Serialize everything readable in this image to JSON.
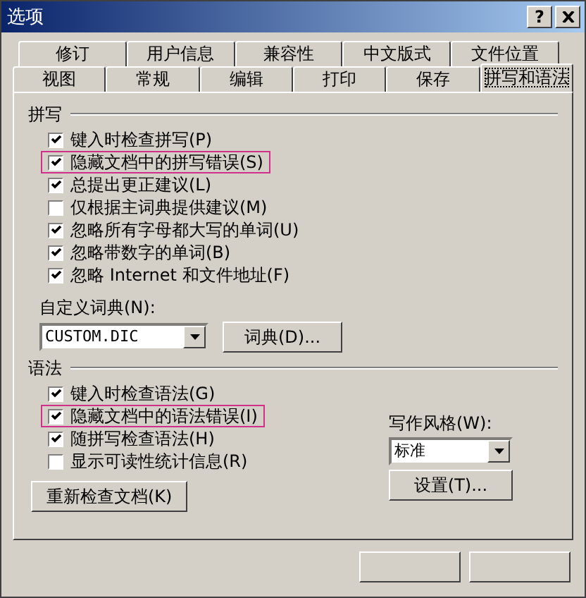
{
  "window": {
    "title": "选项",
    "help_button": "?"
  },
  "tabs": [
    [
      {
        "label": "修订",
        "selected": false
      },
      {
        "label": "用户信息",
        "selected": false
      },
      {
        "label": "兼容性",
        "selected": false
      },
      {
        "label": "中文版式",
        "selected": false
      },
      {
        "label": "文件位置",
        "selected": false
      }
    ],
    [
      {
        "label": "视图",
        "selected": false
      },
      {
        "label": "常规",
        "selected": false
      },
      {
        "label": "编辑",
        "selected": false
      },
      {
        "label": "打印",
        "selected": false
      },
      {
        "label": "保存",
        "selected": false
      },
      {
        "label": "拼写和语法",
        "selected": true
      }
    ]
  ],
  "spelling": {
    "title": "拼写",
    "options": [
      {
        "label": "键入时检查拼写(P)",
        "checked": true,
        "highlighted": false
      },
      {
        "label": "隐藏文档中的拼写错误(S)",
        "checked": true,
        "highlighted": true
      },
      {
        "label": "总提出更正建议(L)",
        "checked": true,
        "highlighted": false
      },
      {
        "label": "仅根据主词典提供建议(M)",
        "checked": false,
        "highlighted": false
      },
      {
        "label": "忽略所有字母都大写的单词(U)",
        "checked": true,
        "highlighted": false
      },
      {
        "label": "忽略带数字的单词(B)",
        "checked": true,
        "highlighted": false
      },
      {
        "label": "忽略 Internet 和文件地址(F)",
        "checked": true,
        "highlighted": false
      }
    ],
    "dictionary_label": "自定义词典(N):",
    "dictionary_value": "CUSTOM.DIC",
    "dictionary_button": "词典(D)..."
  },
  "grammar": {
    "title": "语法",
    "options": [
      {
        "label": "键入时检查语法(G)",
        "checked": true,
        "highlighted": false
      },
      {
        "label": "隐藏文档中的语法错误(I)",
        "checked": true,
        "highlighted": true
      },
      {
        "label": "随拼写检查语法(H)",
        "checked": true,
        "highlighted": false
      },
      {
        "label": "显示可读性统计信息(R)",
        "checked": false,
        "highlighted": false
      }
    ],
    "style_label": "写作风格(W):",
    "style_value": "标准",
    "settings_button": "设置(T)...",
    "recheck_button": "重新检查文档(K)"
  }
}
